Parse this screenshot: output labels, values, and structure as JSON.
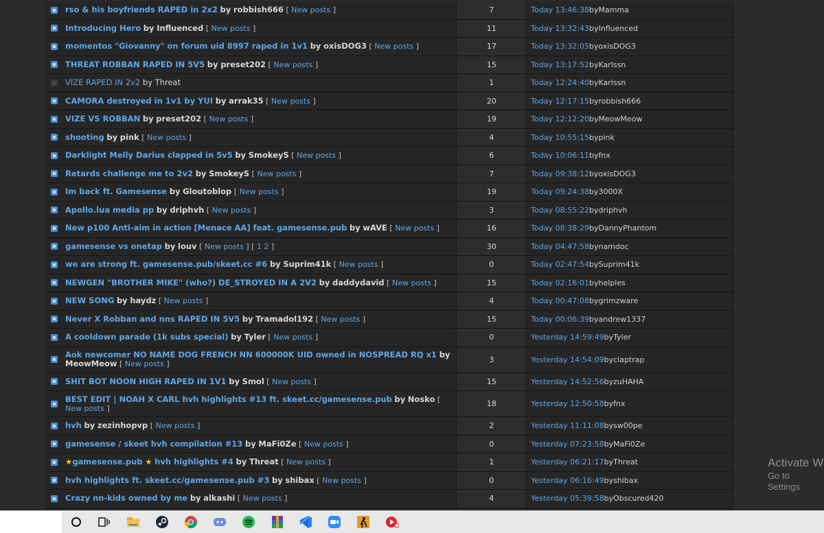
{
  "topics": [
    {
      "title": "rso & his boyfriends RAPED in 2x2",
      "author": "robbish666",
      "new_posts": "New posts",
      "pages": "",
      "replies": "7",
      "last_time": "Today 13:46:38",
      "last_by": "Mamma",
      "read": false,
      "star": false
    },
    {
      "title": "Introducing Hero",
      "author": "Influenced",
      "new_posts": "New posts",
      "pages": "",
      "replies": "11",
      "last_time": "Today 13:32:43",
      "last_by": "Influenced",
      "read": false,
      "star": false
    },
    {
      "title": "momentos \"Giovanny\" on forum uid 8997 raped in 1v1",
      "author": "oxisDOG3",
      "new_posts": "New posts",
      "pages": "",
      "replies": "17",
      "last_time": "Today 13:32:05",
      "last_by": "oxisDOG3",
      "read": false,
      "star": false
    },
    {
      "title": "THREAT ROBBAN RAPED IN 5V5",
      "author": "preset202",
      "new_posts": "New posts",
      "pages": "",
      "replies": "15",
      "last_time": "Today 13:17:52",
      "last_by": "Karlssn",
      "read": false,
      "star": false
    },
    {
      "title": "VIZE RAPED IN 2v2",
      "author": "Threat",
      "new_posts": "",
      "pages": "",
      "replies": "1",
      "last_time": "Today 12:24:40",
      "last_by": "Karlssn",
      "read": true,
      "star": false
    },
    {
      "title": "CAMORA destroyed in 1v1 by YUI",
      "author": "arrak35",
      "new_posts": "New posts",
      "pages": "",
      "replies": "20",
      "last_time": "Today 12:17:15",
      "last_by": "robbish666",
      "read": false,
      "star": false
    },
    {
      "title": "VIZE VS ROBBAN",
      "author": "preset202",
      "new_posts": "New posts",
      "pages": "",
      "replies": "19",
      "last_time": "Today 12:12:20",
      "last_by": "MeowMeow",
      "read": false,
      "star": false
    },
    {
      "title": "shooting",
      "author": "pink",
      "new_posts": "New posts",
      "pages": "",
      "replies": "4",
      "last_time": "Today 10:55:15",
      "last_by": "pink",
      "read": false,
      "star": false
    },
    {
      "title": "Darklight Melly Darius clapped in 5v5",
      "author": "SmokeyS",
      "new_posts": "New posts",
      "pages": "",
      "replies": "6",
      "last_time": "Today 10:06:11",
      "last_by": "fnx",
      "read": false,
      "star": false
    },
    {
      "title": "Retards challenge me to 2v2",
      "author": "SmokeyS",
      "new_posts": "New posts",
      "pages": "",
      "replies": "7",
      "last_time": "Today 09:38:12",
      "last_by": "oxisDOG3",
      "read": false,
      "star": false
    },
    {
      "title": "Im back ft. Gamesense",
      "author": "Gloutoblop",
      "new_posts": "New posts",
      "pages": "",
      "replies": "19",
      "last_time": "Today 09:24:38",
      "last_by": "3000X",
      "read": false,
      "star": false
    },
    {
      "title": "Apollo.lua media pp",
      "author": "driphvh",
      "new_posts": "New posts",
      "pages": "",
      "replies": "3",
      "last_time": "Today 08:55:22",
      "last_by": "driphvh",
      "read": false,
      "star": false
    },
    {
      "title": "New p100 Anti-aim in action [Menace AA] feat. gamesense.pub",
      "author": "wAVE",
      "new_posts": "New posts",
      "pages": "",
      "replies": "16",
      "last_time": "Today 08:38:29",
      "last_by": "DannyPhantom",
      "read": false,
      "star": false
    },
    {
      "title": "gamesense vs onetap",
      "author": "louv",
      "new_posts": "New posts",
      "pages": "1 2",
      "replies": "30",
      "last_time": "Today 04:47:58",
      "last_by": "namdoc",
      "read": false,
      "star": false
    },
    {
      "title": "we are strong ft. gamesense.pub/skeet.cc #6",
      "author": "Suprim41k",
      "new_posts": "New posts",
      "pages": "",
      "replies": "0",
      "last_time": "Today 02:47:54",
      "last_by": "Suprim41k",
      "read": false,
      "star": false
    },
    {
      "title": "NEWGEN \"BROTHER MIKE\" (who?) DE_STROYED IN A 2V2",
      "author": "daddydavid",
      "new_posts": "New posts",
      "pages": "",
      "replies": "15",
      "last_time": "Today 02:16:01",
      "last_by": "helples",
      "read": false,
      "star": false
    },
    {
      "title": "NEW SONG",
      "author": "haydz",
      "new_posts": "New posts",
      "pages": "",
      "replies": "4",
      "last_time": "Today 00:47:08",
      "last_by": "grimzware",
      "read": false,
      "star": false
    },
    {
      "title": "Never X Robban and nns RAPED IN 5V5",
      "author": "Tramadol192",
      "new_posts": "New posts",
      "pages": "",
      "replies": "15",
      "last_time": "Today 00:06:39",
      "last_by": "andrew1337",
      "read": false,
      "star": false
    },
    {
      "title": "A cooldown parade (1k subs special)",
      "author": "Tyler",
      "new_posts": "New posts",
      "pages": "",
      "replies": "0",
      "last_time": "Yesterday 14:59:49",
      "last_by": "Tyler",
      "read": false,
      "star": false
    },
    {
      "title": "Aok newcomer NO NAME DOG FRENCH NN 600000K UID owned in NOSPREAD RQ x1",
      "author": "MeowMeow",
      "new_posts": "New posts",
      "pages": "",
      "replies": "3",
      "last_time": "Yesterday 14:54:09",
      "last_by": "claptrap",
      "read": false,
      "star": false
    },
    {
      "title": "SHIT BOT NOON HIGH RAPED IN 1V1",
      "author": "Smol",
      "new_posts": "New posts",
      "pages": "",
      "replies": "15",
      "last_time": "Yesterday 14:52:56",
      "last_by": "zuHAHA",
      "read": false,
      "star": false
    },
    {
      "title": "BEST EDIT | NOAH X CARL hvh highlights #13 ft. skeet.cc/gamesense.pub",
      "author": "Nosko",
      "new_posts": "New posts",
      "pages": "",
      "replies": "18",
      "last_time": "Yesterday 12:50:58",
      "last_by": "fnx",
      "read": false,
      "star": false
    },
    {
      "title": "hvh",
      "author": "zezinhopvp",
      "new_posts": "New posts",
      "pages": "",
      "replies": "2",
      "last_time": "Yesterday 11:11:08",
      "last_by": "sw00pe",
      "read": false,
      "star": false
    },
    {
      "title": "gamesense / skeet hvh compilation #13",
      "author": "MaFi0Ze",
      "new_posts": "New posts",
      "pages": "",
      "replies": "0",
      "last_time": "Yesterday 07:23:58",
      "last_by": "MaFi0Ze",
      "read": false,
      "star": false
    },
    {
      "title": "gamesense.pub",
      "title_suffix": "hvh highlights #4",
      "author": "Threat",
      "new_posts": "New posts",
      "pages": "",
      "replies": "1",
      "last_time": "Yesterday 06:21:17",
      "last_by": "Threat",
      "read": false,
      "star": true
    },
    {
      "title": "hvh highlights ft. skeet.cc/gamesense.pub #3",
      "author": "shibax",
      "new_posts": "New posts",
      "pages": "",
      "replies": "0",
      "last_time": "Yesterday 06:16:49",
      "last_by": "shibax",
      "read": false,
      "star": false
    },
    {
      "title": "Crazy nn-kids owned by me",
      "author": "alkashi",
      "new_posts": "New posts",
      "pages": "",
      "replies": "4",
      "last_time": "Yesterday 05:39:58",
      "last_by": "Obscured420",
      "read": false,
      "star": false
    }
  ],
  "labels": {
    "by": "by",
    "star": "★"
  },
  "watermark": {
    "line1": "Activate W",
    "line2": "Go to Settings"
  },
  "taskbar": {
    "icons": [
      "cortana-circle-icon",
      "task-view-icon",
      "file-explorer-icon",
      "steam-icon",
      "chrome-icon",
      "discord-icon",
      "spotify-icon",
      "winrar-icon",
      "vscode-icon",
      "zoom-icon",
      "csgo-icon",
      "media-player-icon"
    ]
  },
  "colors": {
    "link": "#5ea7e8",
    "background": "#2b2b2b",
    "row": "#262626",
    "replies_col": "#2d2d2d",
    "star": "#f1c232"
  }
}
